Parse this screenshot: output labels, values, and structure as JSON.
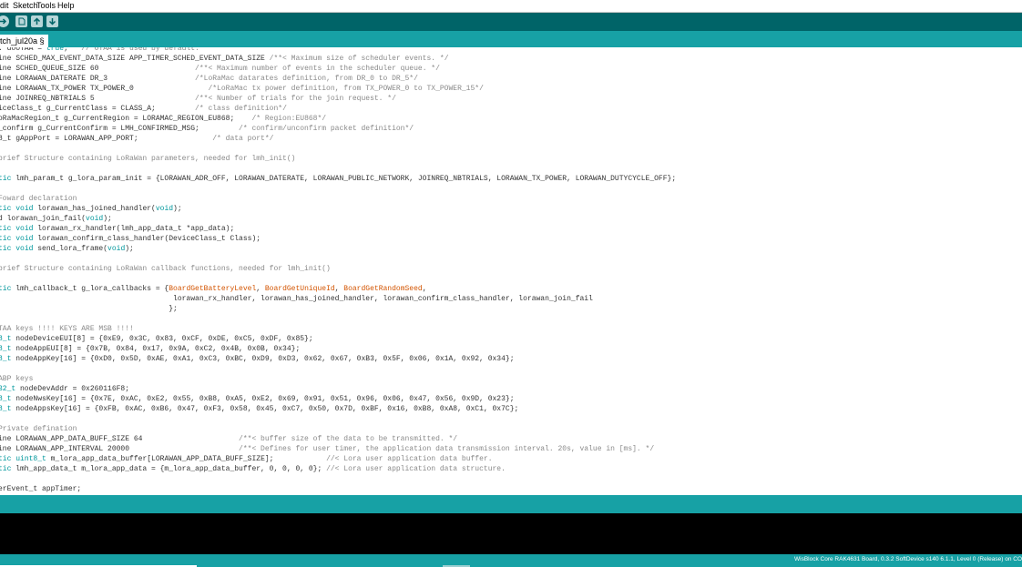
{
  "menubar": {
    "items": [
      "dit",
      "Sketch",
      "Tools",
      "Help"
    ]
  },
  "toolbar": {
    "buttons": [
      "upload-icon",
      "new-icon",
      "open-icon",
      "save-icon"
    ]
  },
  "tab": {
    "label": "tch_jul20a §"
  },
  "editor": {
    "lines": [
      [
        {
          "t": ". doOTAA = "
        },
        {
          "t": "true",
          "c": "kw"
        },
        {
          "t": ";   "
        },
        {
          "t": "// OTAA is used by default.",
          "c": "cm"
        }
      ],
      [
        {
          "t": "ine SCHED_MAX_EVENT_DATA_SIZE APP_TIMER_SCHED_EVENT_DATA_SIZE "
        },
        {
          "t": "/**< Maximum size of scheduler events. */",
          "c": "cm"
        }
      ],
      [
        {
          "t": "ine SCHED_QUEUE_SIZE 60                      "
        },
        {
          "t": "/**< Maximum number of events in the scheduler queue. */",
          "c": "cm"
        }
      ],
      [
        {
          "t": "ine LORAWAN_DATERATE DR_3                    "
        },
        {
          "t": "/*LoRaMac datarates definition, from DR_0 to DR_5*/",
          "c": "cm"
        }
      ],
      [
        {
          "t": "ine LORAWAN_TX_POWER TX_POWER_0                 "
        },
        {
          "t": "/*LoRaMac tx power definition, from TX_POWER_0 to TX_POWER_15*/",
          "c": "cm"
        }
      ],
      [
        {
          "t": "ine JOINREQ_NBTRIALS 5                       "
        },
        {
          "t": "/**< Number of trials for the join request. */",
          "c": "cm"
        }
      ],
      [
        {
          "t": "iceClass_t g_CurrentClass = CLASS_A;         "
        },
        {
          "t": "/* class definition*/",
          "c": "cm"
        }
      ],
      [
        {
          "t": "oRaMacRegion_t g_CurrentRegion = LORAMAC_REGION_EU868;    "
        },
        {
          "t": "/* Region:EU868*/",
          "c": "cm"
        }
      ],
      [
        {
          "t": "_confirm g_CurrentConfirm = LMH_CONFIRMED_MSG;         "
        },
        {
          "t": "/* confirm/unconfirm packet definition*/",
          "c": "cm"
        }
      ],
      [
        {
          "t": "8_t gAppPort = LORAWAN_APP_PORT;                 "
        },
        {
          "t": "/* data port*/",
          "c": "cm"
        }
      ],
      [],
      [
        {
          "t": "brief Structure containing LoRaWan parameters, needed for lmh_init()",
          "c": "cm"
        }
      ],
      [],
      [
        {
          "t": "tic",
          "c": "kw"
        },
        {
          "t": " lmh_param_t g_lora_param_init = {LORAWAN_ADR_OFF, LORAWAN_DATERATE, LORAWAN_PUBLIC_NETWORK, JOINREQ_NBTRIALS, LORAWAN_TX_POWER, LORAWAN_DUTYCYCLE_OFF};"
        }
      ],
      [],
      [
        {
          "t": "Foward declaration",
          "c": "cm"
        }
      ],
      [
        {
          "t": "tic",
          "c": "kw"
        },
        {
          "t": " "
        },
        {
          "t": "void",
          "c": "kw"
        },
        {
          "t": " lorawan_has_joined_handler("
        },
        {
          "t": "void",
          "c": "kw"
        },
        {
          "t": ");"
        }
      ],
      [
        {
          "t": "d lorawan_join_fail("
        },
        {
          "t": "void",
          "c": "kw"
        },
        {
          "t": ");"
        }
      ],
      [
        {
          "t": "tic",
          "c": "kw"
        },
        {
          "t": " "
        },
        {
          "t": "void",
          "c": "kw"
        },
        {
          "t": " lorawan_rx_handler(lmh_app_data_t *app_data);"
        }
      ],
      [
        {
          "t": "tic",
          "c": "kw"
        },
        {
          "t": " "
        },
        {
          "t": "void",
          "c": "kw"
        },
        {
          "t": " lorawan_confirm_class_handler(DeviceClass_t Class);"
        }
      ],
      [
        {
          "t": "tic",
          "c": "kw"
        },
        {
          "t": " "
        },
        {
          "t": "void",
          "c": "kw"
        },
        {
          "t": " send_lora_frame("
        },
        {
          "t": "void",
          "c": "kw"
        },
        {
          "t": ");"
        }
      ],
      [],
      [
        {
          "t": "brief Structure containing LoRaWan callback functions, needed for lmh_init()",
          "c": "cm"
        }
      ],
      [],
      [
        {
          "t": "tic",
          "c": "kw"
        },
        {
          "t": " lmh_callback_t g_lora_callbacks = {"
        },
        {
          "t": "BoardGetBatteryLevel",
          "c": "fn"
        },
        {
          "t": ", "
        },
        {
          "t": "BoardGetUniqueId",
          "c": "fn"
        },
        {
          "t": ", "
        },
        {
          "t": "BoardGetRandomSeed",
          "c": "fn"
        },
        {
          "t": ","
        }
      ],
      [
        {
          "t": "                                        lorawan_rx_handler, lorawan_has_joined_handler, lorawan_confirm_class_handler, lorawan_join_fail"
        }
      ],
      [
        {
          "t": "                                       };"
        }
      ],
      [],
      [
        {
          "t": "TAA keys !!!! KEYS ARE MSB !!!!",
          "c": "cm"
        }
      ],
      [
        {
          "t": "8_t",
          "c": "kw"
        },
        {
          "t": " nodeDeviceEUI[8] = {0xE9, 0x3C, 0x83, 0xCF, 0xDE, 0xC5, 0xDF, 0x85};"
        }
      ],
      [
        {
          "t": "8_t",
          "c": "kw"
        },
        {
          "t": " nodeAppEUI[8] = {0x7B, 0x84, 0x17, 0x9A, 0xC2, 0x4B, 0x0B, 0x34};"
        }
      ],
      [
        {
          "t": "8_t",
          "c": "kw"
        },
        {
          "t": " nodeAppKey[16] = {0xD0, 0x5D, 0xAE, 0xA1, 0xC3, 0xBC, 0xD9, 0xD3, 0x62, 0x67, 0xB3, 0x5F, 0x06, 0x1A, 0x92, 0x34};"
        }
      ],
      [],
      [
        {
          "t": "ABP keys",
          "c": "cm"
        }
      ],
      [
        {
          "t": "32_t",
          "c": "kw"
        },
        {
          "t": " nodeDevAddr = 0x260116F8;"
        }
      ],
      [
        {
          "t": "8_t",
          "c": "kw"
        },
        {
          "t": " nodeNwsKey[16] = {0x7E, 0xAC, 0xE2, 0x55, 0xB8, 0xA5, 0xE2, 0x69, 0x91, 0x51, 0x96, 0x06, 0x47, 0x56, 0x9D, 0x23};"
        }
      ],
      [
        {
          "t": "8_t",
          "c": "kw"
        },
        {
          "t": " nodeAppsKey[16] = {0xFB, 0xAC, 0xB6, 0x47, 0xF3, 0x58, 0x45, 0xC7, 0x50, 0x7D, 0xBF, 0x16, 0xB8, 0xA8, 0xC1, 0x7C};"
        }
      ],
      [],
      [
        {
          "t": "Private defination",
          "c": "cm"
        }
      ],
      [
        {
          "t": "ine LORAWAN_APP_DATA_BUFF_SIZE 64                      "
        },
        {
          "t": "/**< buffer size of the data to be transmitted. */",
          "c": "cm"
        }
      ],
      [
        {
          "t": "ine LORAWAN_APP_INTERVAL 20000                         "
        },
        {
          "t": "/**< Defines for user timer, the application data transmission interval. 20s, value in [ms]. */",
          "c": "cm"
        }
      ],
      [
        {
          "t": "tic",
          "c": "kw"
        },
        {
          "t": " "
        },
        {
          "t": "uint8_t",
          "c": "kw"
        },
        {
          "t": " m_lora_app_data_buffer[LORAWAN_APP_DATA_BUFF_SIZE];            "
        },
        {
          "t": "//< Lora user application data buffer.",
          "c": "cm"
        }
      ],
      [
        {
          "t": "tic",
          "c": "kw"
        },
        {
          "t": " lmh_app_data_t m_lora_app_data = {m_lora_app_data_buffer, 0, 0, 0, 0}; "
        },
        {
          "t": "//< Lora user application data structure.",
          "c": "cm"
        }
      ],
      [],
      [
        {
          "t": "erEvent_t appTimer;"
        }
      ]
    ]
  },
  "status": {
    "text": "WisBlock Core RAK4631 Board, 0.3.2 SoftDevice s140 6.1.1, Level 0 (Release) on CO"
  },
  "colors": {
    "toolbar": "#006468",
    "accent": "#17a1a5",
    "keyword": "#00979c",
    "comment": "#8a8a8a",
    "function": "#d35400"
  }
}
